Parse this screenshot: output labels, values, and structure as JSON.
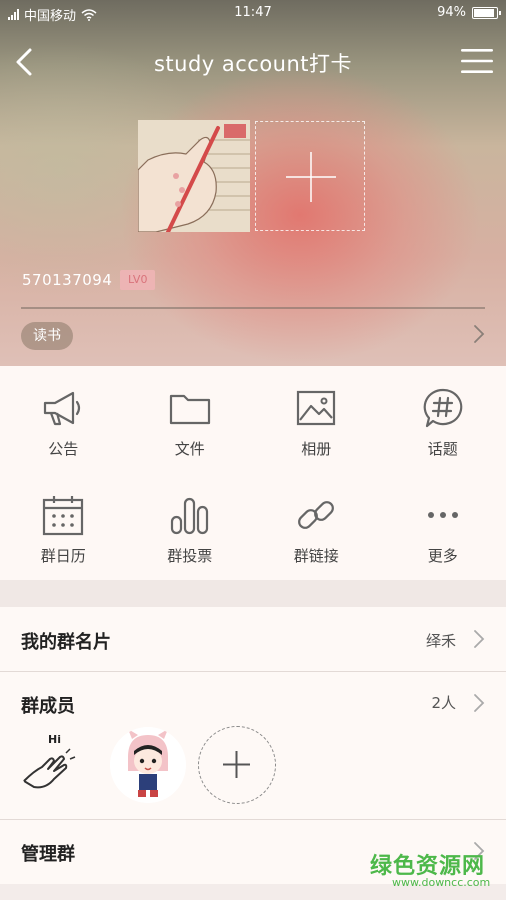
{
  "status_bar": {
    "carrier": "中国移动",
    "time": "11:47",
    "battery_text": "94%",
    "battery_level": 0.94
  },
  "navbar": {
    "title": "study account打卡",
    "back_icon": "chevron-left-icon",
    "menu_icon": "hamburger-menu-icon"
  },
  "profile": {
    "group_id": "570137094",
    "level": "LV0",
    "tag": "读书"
  },
  "functions": [
    {
      "label": "公告",
      "icon": "megaphone-icon"
    },
    {
      "label": "文件",
      "icon": "folder-icon"
    },
    {
      "label": "相册",
      "icon": "image-icon"
    },
    {
      "label": "话题",
      "icon": "hashtag-icon"
    },
    {
      "label": "群日历",
      "icon": "calendar-icon"
    },
    {
      "label": "群投票",
      "icon": "bar-chart-icon"
    },
    {
      "label": "群链接",
      "icon": "link-icon"
    },
    {
      "label": "更多",
      "icon": "more-icon"
    }
  ],
  "list": {
    "card": {
      "label": "我的群名片",
      "value": "绎禾"
    },
    "members": {
      "label": "群成员",
      "value": "2人"
    },
    "manage": {
      "label": "管理群"
    }
  },
  "member_avatar_text": "Hi",
  "watermark": {
    "main": "绿色资源网",
    "sub": "www.downcc.com"
  },
  "colors": {
    "accent_pink": "#d9737b",
    "watermark_green": "#4db84a",
    "icon_gray": "#666666"
  }
}
